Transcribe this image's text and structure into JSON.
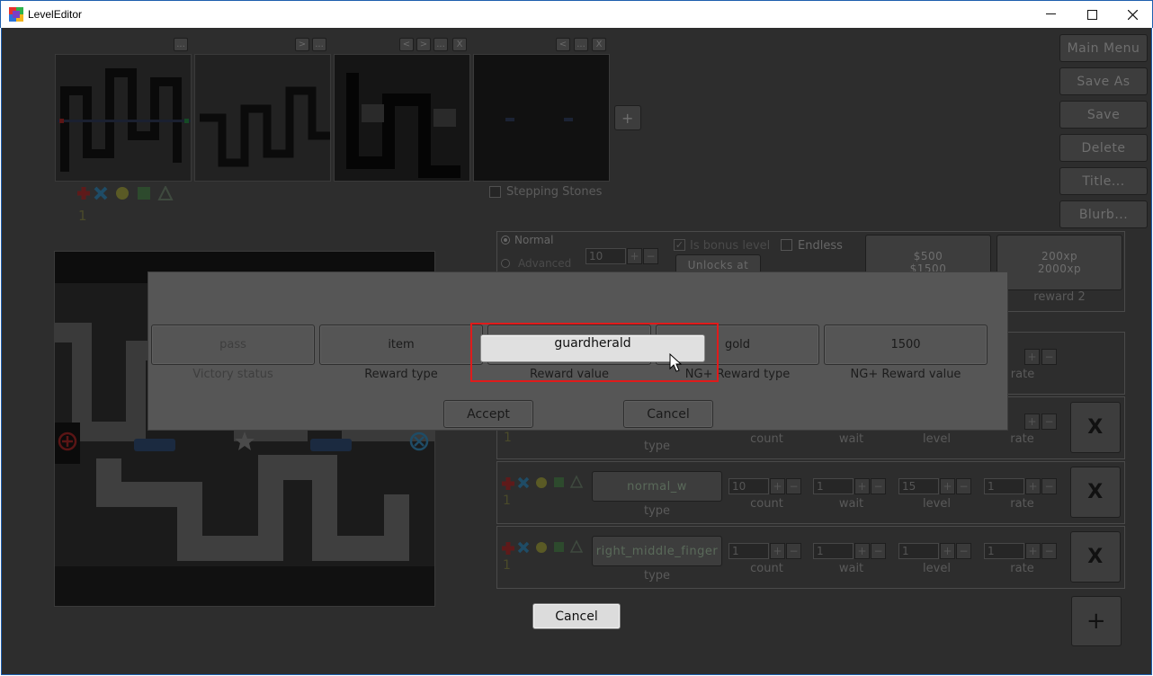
{
  "window": {
    "title": "LevelEditor",
    "controls": {
      "minimize": "—",
      "maximize": "☐",
      "close": "✕"
    }
  },
  "thumb_controls": {
    "t1": [
      "..."
    ],
    "t2": [
      ">",
      "..."
    ],
    "t3": [
      "<",
      ">",
      "...",
      "X"
    ],
    "t4": [
      "<",
      "...",
      "X"
    ]
  },
  "add_level_button": "+",
  "stepping_stones_label": "Stepping Stones",
  "right_menu": [
    "Main Menu",
    "Save As",
    "Save",
    "Delete",
    "Title...",
    "Blurb..."
  ],
  "settings": {
    "mode_normal": "Normal",
    "mode_advanced": "Advanced",
    "spin_value": "10",
    "is_bonus_label": "Is bonus level",
    "endless_label": "Endless",
    "unlocks_label": "Unlocks at",
    "reward1_line1": "$500",
    "reward1_line2": "$1500",
    "reward2_line1": "200xp",
    "reward2_line2": "2000xp",
    "reward2_caption": "reward 2"
  },
  "wave_headers": {
    "type": "type",
    "count": "count",
    "wait": "wait",
    "level": "level",
    "rate": "rate"
  },
  "waves": [
    {
      "type": "normal_w",
      "count": "10",
      "wait": "1",
      "level": "15",
      "rate": "1"
    },
    {
      "type": "right_middle_finger",
      "count": "1",
      "wait": "1",
      "level": "1",
      "rate": "1"
    }
  ],
  "remove_wave_label": "X",
  "add_wave_label": "+",
  "dialog": {
    "fields": [
      {
        "value": "pass",
        "label": "Victory status",
        "disabled": true
      },
      {
        "value": "item",
        "label": "Reward type"
      },
      {
        "value": "guardherald",
        "label": "Reward value",
        "focused": true
      },
      {
        "value": "gold",
        "label": "NG+ Reward type"
      },
      {
        "value": "1500",
        "label": "NG+ Reward value"
      }
    ],
    "accept_label": "Accept",
    "cancel_label": "Cancel"
  },
  "bottom_cancel_label": "Cancel",
  "colors": {
    "highlight": "#e01b1b",
    "overlay": "#2d2d2d",
    "dialog": "#565656"
  }
}
